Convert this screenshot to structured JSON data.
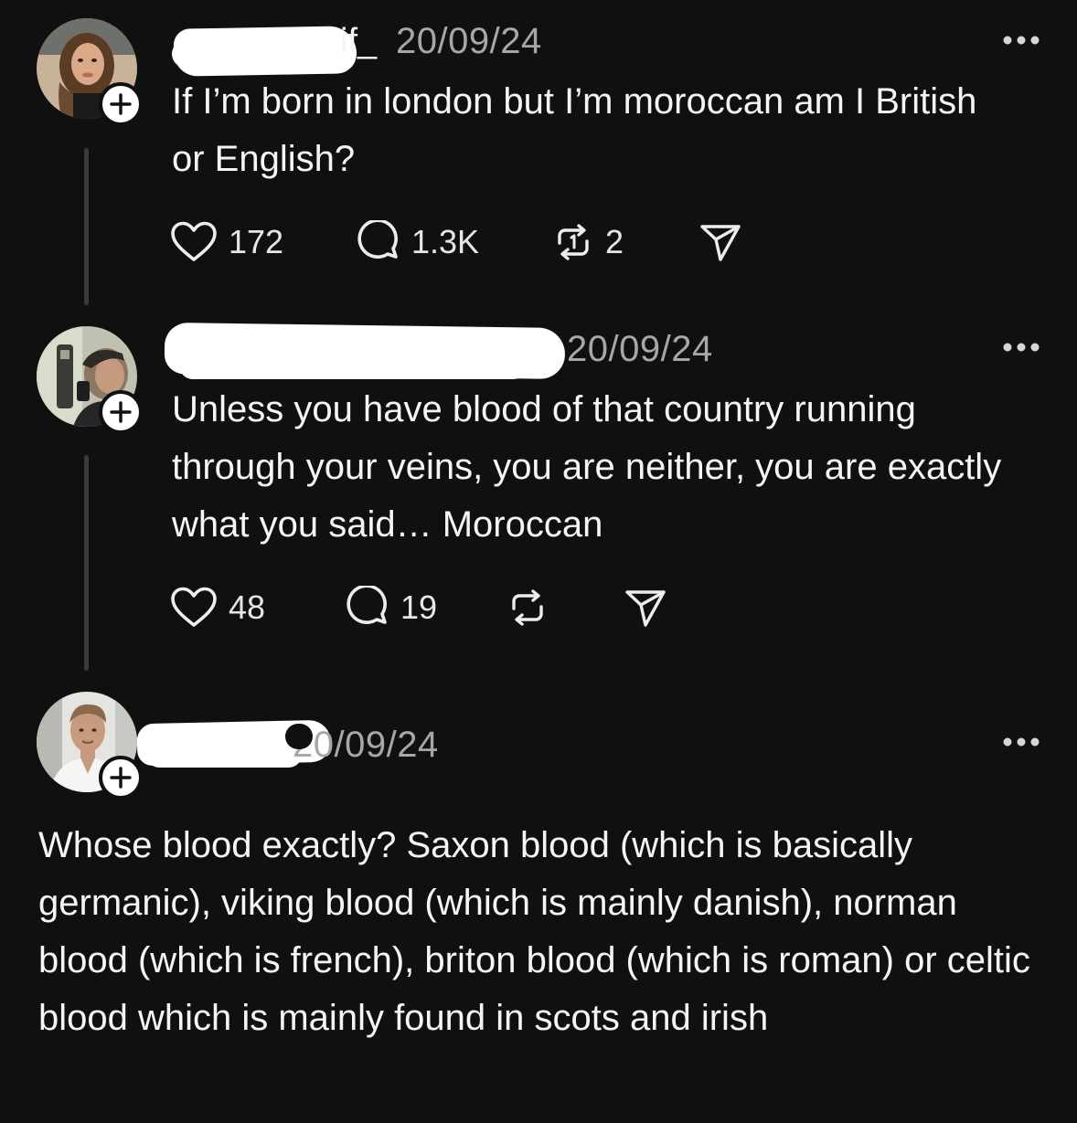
{
  "posts": [
    {
      "handle_tail": "if_",
      "date": "20/09/24",
      "text": "If I’m born in london but I’m moroccan am I British or English?",
      "actions": {
        "likes": "172",
        "replies": "1.3K",
        "reposts": "2"
      }
    },
    {
      "date": "20/09/24",
      "text": "Unless you have blood of that country running through your veins, you are neither, you are exactly what you said… Moroccan",
      "actions": {
        "likes": "48",
        "replies": "19",
        "reposts": ""
      }
    },
    {
      "date": "20/09/24",
      "text": "Whose blood exactly? Saxon blood (which is basically germanic), viking blood (which is mainly danish), norman blood (which is french), briton blood (which is roman) or celtic blood which is mainly found in scots and irish"
    }
  ],
  "icons": {
    "like": "heart-icon",
    "reply": "speech-bubble-icon",
    "repost": "repost-icon",
    "share": "paper-plane-icon",
    "more": "ellipsis-icon",
    "follow": "plus-icon"
  },
  "colors": {
    "background": "#101010",
    "text": "#f3f5f7",
    "secondary_text": "#a7a7a7",
    "thread_line": "#3a3a3a"
  }
}
